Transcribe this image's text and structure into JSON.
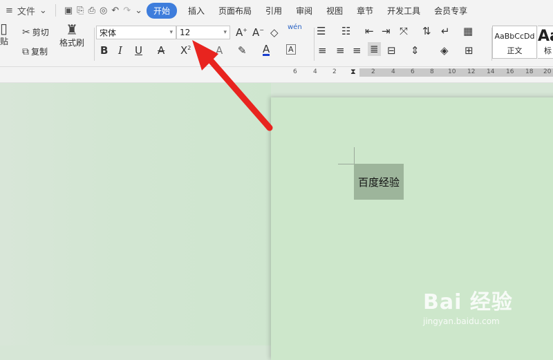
{
  "menubar": {
    "file_label": "文件",
    "tabs": [
      "开始",
      "插入",
      "页面布局",
      "引用",
      "审阅",
      "视图",
      "章节",
      "开发工具",
      "会员专享"
    ]
  },
  "clipboard": {
    "paste_label": "贴",
    "cut_label": "剪切",
    "copy_label": "复制",
    "format_painter_label": "格式刷"
  },
  "font": {
    "family": "宋体",
    "size": "12",
    "bold": "B",
    "italic": "I",
    "underline": "U",
    "font_color": "A",
    "superscript": "X",
    "grow": "A",
    "shrink": "A",
    "pinyin": "wén",
    "char_border": "A"
  },
  "styles": {
    "normal_preview": "AaBbCcDd",
    "normal_label": "正文",
    "heading_preview": "Aa",
    "heading_label": "标"
  },
  "ruler": {
    "numbers": [
      "6",
      "4",
      "2",
      "2",
      "4",
      "6",
      "8",
      "10",
      "12",
      "14",
      "16",
      "18",
      "20"
    ]
  },
  "document": {
    "selected_text": "百度经验"
  },
  "watermark": {
    "main": "Bai 经验",
    "sub": "jingyan.baidu.com"
  },
  "colors": {
    "accent": "#3e7ddc",
    "arrow": "#e8241f",
    "page": "#cde7cb",
    "selection": "#9db59b"
  }
}
